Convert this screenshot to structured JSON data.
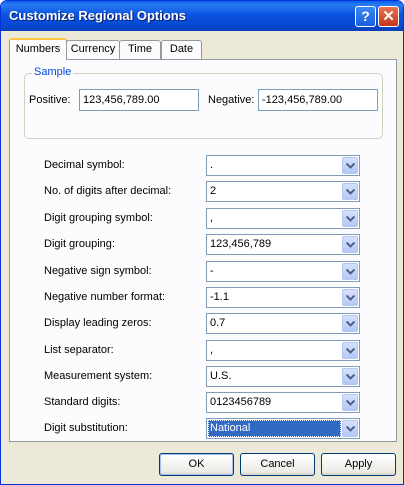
{
  "window": {
    "title": "Customize Regional Options"
  },
  "title_buttons": {
    "help": "?",
    "close": "✕"
  },
  "tabs": [
    {
      "label": "Numbers",
      "active": true
    },
    {
      "label": "Currency",
      "active": false
    },
    {
      "label": "Time",
      "active": false
    },
    {
      "label": "Date",
      "active": false
    }
  ],
  "sample": {
    "legend": "Sample",
    "positive_label": "Positive:",
    "positive_value": "123,456,789.00",
    "negative_label": "Negative:",
    "negative_value": "-123,456,789.00"
  },
  "settings": [
    {
      "label": "Decimal symbol:",
      "value": "."
    },
    {
      "label": "No. of digits after decimal:",
      "value": "2"
    },
    {
      "label": "Digit grouping symbol:",
      "value": ","
    },
    {
      "label": "Digit grouping:",
      "value": "123,456,789"
    },
    {
      "label": "Negative sign symbol:",
      "value": "-"
    },
    {
      "label": "Negative number format:",
      "value": "-1.1"
    },
    {
      "label": "Display leading zeros:",
      "value": "0.7"
    },
    {
      "label": "List separator:",
      "value": ","
    },
    {
      "label": "Measurement system:",
      "value": "U.S."
    },
    {
      "label": "Standard digits:",
      "value": "0123456789"
    },
    {
      "label": "Digit substitution:",
      "value": "National"
    }
  ],
  "buttons": {
    "ok": "OK",
    "cancel": "Cancel",
    "apply": "Apply"
  },
  "colors": {
    "title_bar": "#0b54e0",
    "selection": "#316ac5",
    "sample_legend": "#0046d5"
  }
}
